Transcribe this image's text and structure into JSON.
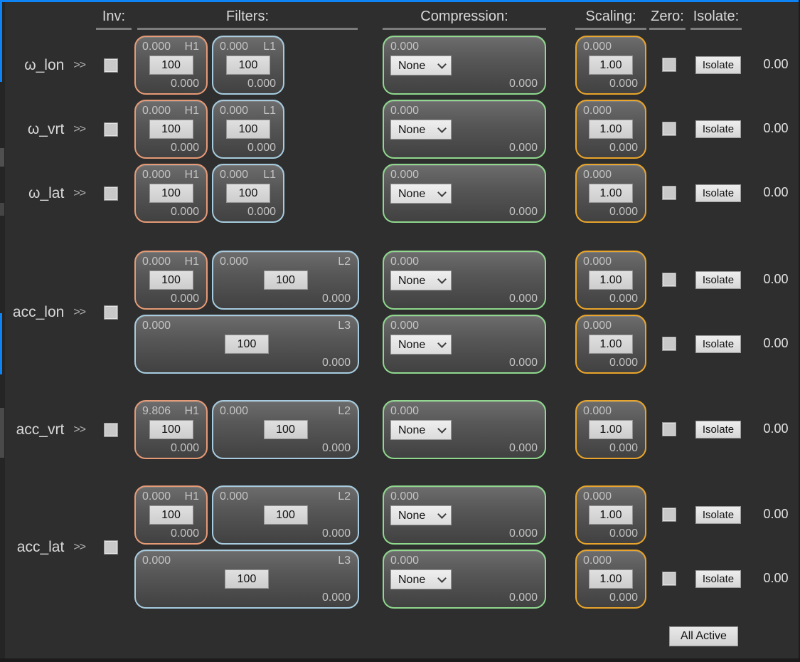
{
  "window": {
    "background": "#2e2e2e",
    "focus_border": "#0e83f6"
  },
  "colors": {
    "highpass_border": "#e69a76",
    "lowpass_border": "#a7cce0",
    "compression_border": "#8fd88d",
    "scaling_border": "#e9a52b"
  },
  "headers": {
    "inv": "Inv:",
    "filters": "Filters:",
    "compression": "Compression:",
    "scaling": "Scaling:",
    "zero": "Zero:",
    "isolate": "Isolate:"
  },
  "buttons": {
    "isolate": "Isolate",
    "all_active": "All Active"
  },
  "compression_options": [
    "None"
  ],
  "channels": [
    {
      "label": "ω_lon",
      "arrow": ">>",
      "inverted": false,
      "rows": [
        {
          "filters": [
            {
              "tag": "H1",
              "type": "highpass",
              "layout": "narrow-left",
              "input": "0.000",
              "cutoff": "100",
              "output": "0.000"
            },
            {
              "tag": "L1",
              "type": "lowpass",
              "layout": "narrow-right",
              "input": "0.000",
              "cutoff": "100",
              "output": "0.000"
            }
          ],
          "compression": {
            "input": "0.000",
            "mode": "None",
            "output": "0.000"
          },
          "scaling": {
            "input": "0.000",
            "factor": "1.00",
            "output": "0.000"
          },
          "zero_checked": false,
          "result": "0.00"
        }
      ]
    },
    {
      "label": "ω_vrt",
      "arrow": ">>",
      "inverted": false,
      "rows": [
        {
          "filters": [
            {
              "tag": "H1",
              "type": "highpass",
              "layout": "narrow-left",
              "input": "0.000",
              "cutoff": "100",
              "output": "0.000"
            },
            {
              "tag": "L1",
              "type": "lowpass",
              "layout": "narrow-right",
              "input": "0.000",
              "cutoff": "100",
              "output": "0.000"
            }
          ],
          "compression": {
            "input": "0.000",
            "mode": "None",
            "output": "0.000"
          },
          "scaling": {
            "input": "0.000",
            "factor": "1.00",
            "output": "0.000"
          },
          "zero_checked": false,
          "result": "0.00"
        }
      ]
    },
    {
      "label": "ω_lat",
      "arrow": ">>",
      "inverted": false,
      "rows": [
        {
          "filters": [
            {
              "tag": "H1",
              "type": "highpass",
              "layout": "narrow-left",
              "input": "0.000",
              "cutoff": "100",
              "output": "0.000"
            },
            {
              "tag": "L1",
              "type": "lowpass",
              "layout": "narrow-right",
              "input": "0.000",
              "cutoff": "100",
              "output": "0.000"
            }
          ],
          "compression": {
            "input": "0.000",
            "mode": "None",
            "output": "0.000"
          },
          "scaling": {
            "input": "0.000",
            "factor": "1.00",
            "output": "0.000"
          },
          "zero_checked": false,
          "result": "0.00"
        }
      ]
    },
    {
      "label": "acc_lon",
      "arrow": ">>",
      "inverted": false,
      "rows": [
        {
          "filters": [
            {
              "tag": "H1",
              "type": "highpass",
              "layout": "narrow-left",
              "input": "0.000",
              "cutoff": "100",
              "output": "0.000"
            },
            {
              "tag": "L2",
              "type": "lowpass",
              "layout": "wide-right",
              "input": "0.000",
              "cutoff": "100",
              "output": "0.000"
            }
          ],
          "compression": {
            "input": "0.000",
            "mode": "None",
            "output": "0.000"
          },
          "scaling": {
            "input": "0.000",
            "factor": "1.00",
            "output": "0.000"
          },
          "zero_checked": false,
          "result": "0.00"
        },
        {
          "filters": [
            {
              "tag": "L3",
              "type": "lowpass",
              "layout": "full",
              "input": "0.000",
              "cutoff": "100",
              "output": "0.000"
            }
          ],
          "compression": {
            "input": "0.000",
            "mode": "None",
            "output": "0.000"
          },
          "scaling": {
            "input": "0.000",
            "factor": "1.00",
            "output": "0.000"
          },
          "zero_checked": false,
          "result": "0.00"
        }
      ]
    },
    {
      "label": "acc_vrt",
      "arrow": ">>",
      "inverted": false,
      "rows": [
        {
          "filters": [
            {
              "tag": "H1",
              "type": "highpass",
              "layout": "narrow-left",
              "input": "9.806",
              "cutoff": "100",
              "output": "0.000"
            },
            {
              "tag": "L2",
              "type": "lowpass",
              "layout": "wide-right",
              "input": "0.000",
              "cutoff": "100",
              "output": "0.000"
            }
          ],
          "compression": {
            "input": "0.000",
            "mode": "None",
            "output": "0.000"
          },
          "scaling": {
            "input": "0.000",
            "factor": "1.00",
            "output": "0.000"
          },
          "zero_checked": false,
          "result": "0.00"
        }
      ]
    },
    {
      "label": "acc_lat",
      "arrow": ">>",
      "inverted": false,
      "rows": [
        {
          "filters": [
            {
              "tag": "H1",
              "type": "highpass",
              "layout": "narrow-left",
              "input": "0.000",
              "cutoff": "100",
              "output": "0.000"
            },
            {
              "tag": "L2",
              "type": "lowpass",
              "layout": "wide-right",
              "input": "0.000",
              "cutoff": "100",
              "output": "0.000"
            }
          ],
          "compression": {
            "input": "0.000",
            "mode": "None",
            "output": "0.000"
          },
          "scaling": {
            "input": "0.000",
            "factor": "1.00",
            "output": "0.000"
          },
          "zero_checked": false,
          "result": "0.00"
        },
        {
          "filters": [
            {
              "tag": "L3",
              "type": "lowpass",
              "layout": "full",
              "input": "0.000",
              "cutoff": "100",
              "output": "0.000"
            }
          ],
          "compression": {
            "input": "0.000",
            "mode": "None",
            "output": "0.000"
          },
          "scaling": {
            "input": "0.000",
            "factor": "1.00",
            "output": "0.000"
          },
          "zero_checked": false,
          "result": "0.00"
        }
      ]
    }
  ]
}
